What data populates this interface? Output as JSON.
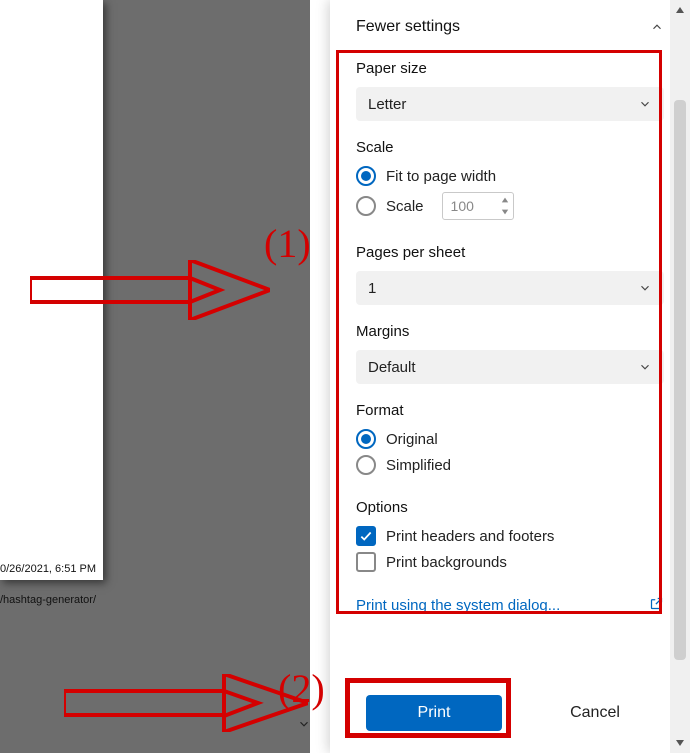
{
  "preview": {
    "footer_date": "0/26/2021, 6:51 PM",
    "footer_url": "/hashtag-generator/"
  },
  "panel": {
    "header": {
      "title": "Fewer settings"
    },
    "paper_size": {
      "label": "Paper size",
      "value": "Letter"
    },
    "scale": {
      "label": "Scale",
      "fit_label": "Fit to page width",
      "scale_label": "Scale",
      "value": "100"
    },
    "pages_per_sheet": {
      "label": "Pages per sheet",
      "value": "1"
    },
    "margins": {
      "label": "Margins",
      "value": "Default"
    },
    "format": {
      "label": "Format",
      "original": "Original",
      "simplified": "Simplified"
    },
    "options": {
      "label": "Options",
      "headers_footers": "Print headers and footers",
      "backgrounds": "Print backgrounds"
    },
    "system_dialog_link": "Print using the system dialog...",
    "print_btn": "Print",
    "cancel_btn": "Cancel"
  },
  "annotations": {
    "num1": "(1)",
    "num2": "(2)"
  }
}
